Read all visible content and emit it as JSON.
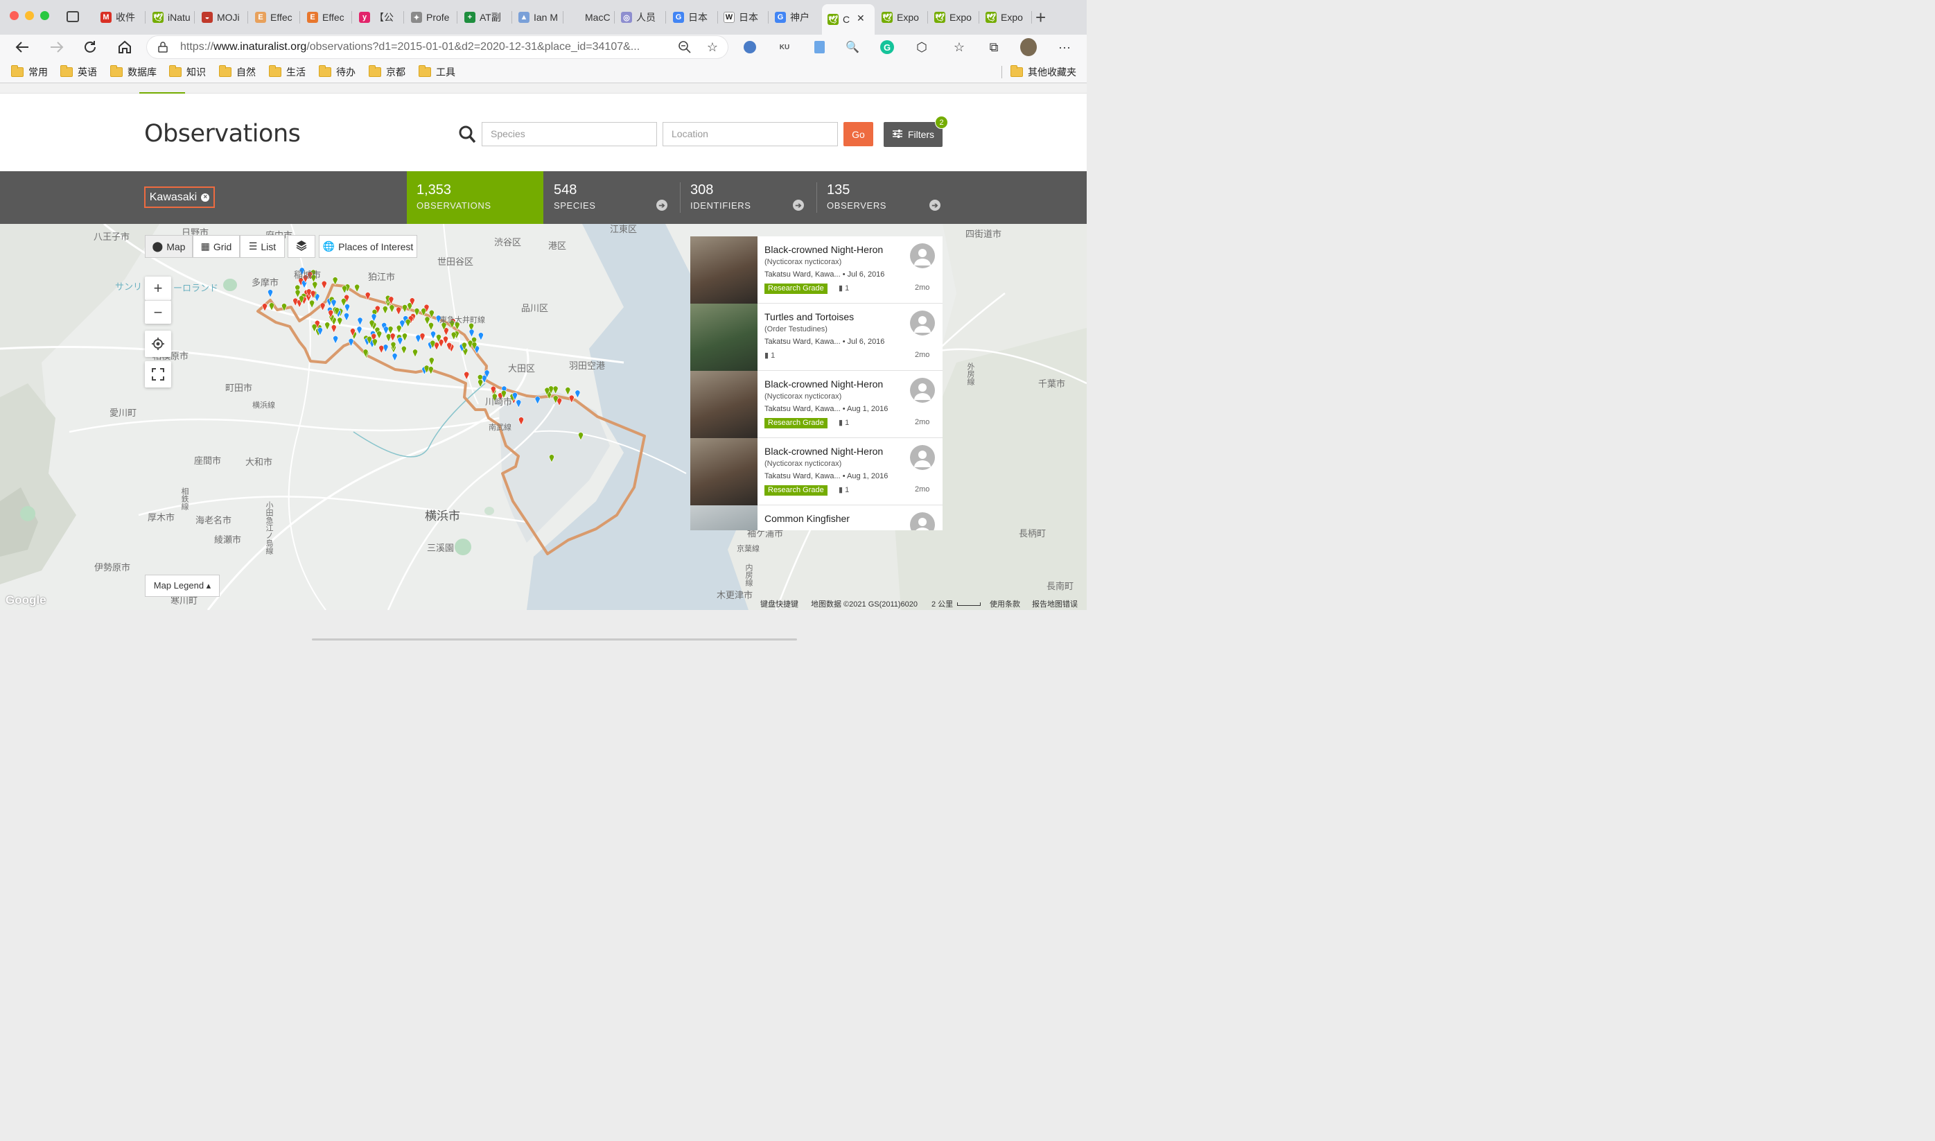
{
  "browser": {
    "tabs": [
      {
        "label": "收件",
        "icon": "gmail-icon",
        "color": "#d93025",
        "glyph": "M"
      },
      {
        "label": "iNatu",
        "icon": "inaturalist-icon",
        "color": "#74ac00",
        "glyph": "🕊"
      },
      {
        "label": "MOJi",
        "icon": "moji-icon",
        "color": "#c0392b",
        "glyph": "◒"
      },
      {
        "label": "Effec",
        "icon": "e-icon",
        "color": "#e8a15c",
        "glyph": "E"
      },
      {
        "label": "Effec",
        "icon": "e-icon",
        "color": "#e8772e",
        "glyph": "E"
      },
      {
        "label": "【公",
        "icon": "y-icon",
        "color": "#e2246a",
        "glyph": "y"
      },
      {
        "label": "Profe",
        "icon": "profe-icon",
        "color": "#8a8a8a",
        "glyph": "✦"
      },
      {
        "label": "AT副",
        "icon": "plus-green-icon",
        "color": "#1e8e3e",
        "glyph": "+"
      },
      {
        "label": "Ian M",
        "icon": "ian-icon",
        "color": "#7aa0d8",
        "glyph": "▲"
      },
      {
        "label": "MacC",
        "icon": "macc-icon",
        "color": "#dedfe2",
        "glyph": ""
      },
      {
        "label": "人员",
        "icon": "people-icon",
        "color": "#8e8ecf",
        "glyph": "◎"
      },
      {
        "label": "日本",
        "icon": "google-icon",
        "color": "#4285f4",
        "glyph": "G"
      },
      {
        "label": "日本",
        "icon": "wikipedia-icon",
        "color": "#ffffff",
        "glyph": "W"
      },
      {
        "label": "神户",
        "icon": "google-icon",
        "color": "#4285f4",
        "glyph": "G"
      },
      {
        "label": "C",
        "icon": "inaturalist-icon",
        "color": "#74ac00",
        "glyph": "🕊"
      },
      {
        "label": "Expo",
        "icon": "inaturalist-icon",
        "color": "#74ac00",
        "glyph": "🕊"
      },
      {
        "label": "Expo",
        "icon": "inaturalist-icon",
        "color": "#74ac00",
        "glyph": "🕊"
      },
      {
        "label": "Expo",
        "icon": "inaturalist-icon",
        "color": "#74ac00",
        "glyph": "🕊"
      }
    ],
    "url_prefix": "https://",
    "url_host": "www.inaturalist.org",
    "url_path": "/observations?d1=2015-01-01&d2=2020-12-31&place_id=34107&...",
    "bookmarks": [
      "常用",
      "英语",
      "数据库",
      "知识",
      "自然",
      "生活",
      "待办",
      "京都",
      "工具"
    ],
    "other_bookmarks": "其他收藏夹"
  },
  "page": {
    "title": "Observations",
    "species_placeholder": "Species",
    "location_placeholder": "Location",
    "go_label": "Go",
    "filters_label": "Filters",
    "filters_count": "2",
    "place_chip": "Kawasaki",
    "stats": [
      {
        "num": "1,353",
        "label": "OBSERVATIONS"
      },
      {
        "num": "548",
        "label": "SPECIES"
      },
      {
        "num": "308",
        "label": "IDENTIFIERS"
      },
      {
        "num": "135",
        "label": "OBSERVERS"
      }
    ]
  },
  "map": {
    "view_buttons": {
      "map": "Map",
      "grid": "Grid",
      "list": "List",
      "places": "Places of Interest"
    },
    "legend_label": "Map Legend ▴",
    "google_logo": "Google",
    "attribution": {
      "shortcuts": "键盘快捷键",
      "data": "地图数据 ©2021 GS(2011)6020",
      "scale": "2 公里",
      "terms": "使用条款",
      "report": "报告地图错误"
    },
    "place_labels": [
      "八王子市",
      "日野市",
      "府中市",
      "多摩市",
      "稲城市",
      "狛江市",
      "渋谷区",
      "港区",
      "江東区",
      "世田谷区",
      "品川区",
      "大田区",
      "羽田空港",
      "町田市",
      "相模原市",
      "座間市",
      "大和市",
      "厚木市",
      "海老名市",
      "綾瀬市",
      "横浜市",
      "三溪園",
      "伊勢原市",
      "愛川町",
      "四街道市",
      "千葉市",
      "木更津市",
      "袖ケ浦市",
      "長柄町",
      "長南町",
      "寒川町",
      "東急大井町線",
      "横浜線",
      "南武線",
      "京葉線",
      "サンリ",
      "ーロランド",
      "小田急江ノ島線",
      "相鉄線",
      "川崎市",
      "内房線",
      "外房線"
    ]
  },
  "observations": [
    {
      "name": "Black-crowned Night-Heron",
      "sci": "(Nycticorax nycticorax)",
      "meta": "Takatsu Ward, Kawa...  • Jul 6, 2016",
      "grade": "Research Grade",
      "ids": "1",
      "ago": "2mo",
      "photo": "heron-photo"
    },
    {
      "name": "Turtles and Tortoises",
      "sci": "(Order Testudines)",
      "meta": "Takatsu Ward, Kawa...  • Jul 6, 2016",
      "grade": "",
      "ids": "1",
      "ago": "2mo",
      "photo": "turtle-photo"
    },
    {
      "name": "Black-crowned Night-Heron",
      "sci": "(Nycticorax nycticorax)",
      "meta": "Takatsu Ward, Kawa...  • Aug 1, 2016",
      "grade": "Research Grade",
      "ids": "1",
      "ago": "2mo",
      "photo": "heron-photo"
    },
    {
      "name": "Black-crowned Night-Heron",
      "sci": "(Nycticorax nycticorax)",
      "meta": "Takatsu Ward, Kawa...  • Aug 1, 2016",
      "grade": "Research Grade",
      "ids": "1",
      "ago": "2mo",
      "photo": "heron-photo"
    },
    {
      "name": "Common Kingfisher",
      "sci": "",
      "meta": "",
      "grade": "",
      "ids": "",
      "ago": "",
      "photo": "kingfisher-photo"
    }
  ],
  "colors": {
    "brand_green": "#74ac00",
    "accent_orange": "#ee6b40",
    "stats_bg": "#595959",
    "boundary": "#d99a6c"
  }
}
